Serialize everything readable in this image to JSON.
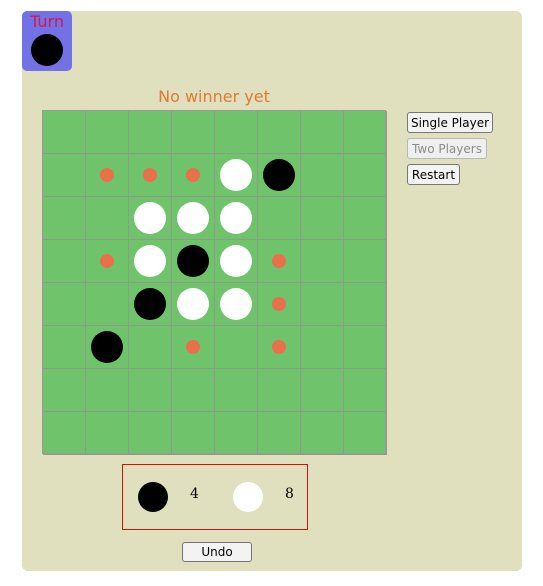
{
  "turn": {
    "label": "Turn",
    "player": "black"
  },
  "status": "No winner yet",
  "buttons": {
    "single_player": "Single Player",
    "two_players": "Two Players",
    "restart": "Restart",
    "undo": "Undo"
  },
  "board": {
    "rows": 8,
    "cols": 8,
    "discs": [
      {
        "row": 1,
        "col": 4,
        "color": "white"
      },
      {
        "row": 1,
        "col": 5,
        "color": "black"
      },
      {
        "row": 2,
        "col": 2,
        "color": "white"
      },
      {
        "row": 2,
        "col": 3,
        "color": "white"
      },
      {
        "row": 2,
        "col": 4,
        "color": "white"
      },
      {
        "row": 3,
        "col": 2,
        "color": "white"
      },
      {
        "row": 3,
        "col": 3,
        "color": "black"
      },
      {
        "row": 3,
        "col": 4,
        "color": "white"
      },
      {
        "row": 4,
        "col": 2,
        "color": "black"
      },
      {
        "row": 4,
        "col": 3,
        "color": "white"
      },
      {
        "row": 4,
        "col": 4,
        "color": "white"
      },
      {
        "row": 5,
        "col": 1,
        "color": "black"
      }
    ],
    "hints": [
      {
        "row": 1,
        "col": 1
      },
      {
        "row": 1,
        "col": 2
      },
      {
        "row": 1,
        "col": 3
      },
      {
        "row": 3,
        "col": 1
      },
      {
        "row": 3,
        "col": 5
      },
      {
        "row": 4,
        "col": 5
      },
      {
        "row": 5,
        "col": 3
      },
      {
        "row": 5,
        "col": 5
      }
    ]
  },
  "score": {
    "black": "4",
    "white": "8"
  },
  "colors": {
    "board": "#6fc46b",
    "hint": "#e8704a",
    "panel": "#e0dfbe",
    "turn_box": "#7371e6",
    "status_text": "#e07a34"
  }
}
